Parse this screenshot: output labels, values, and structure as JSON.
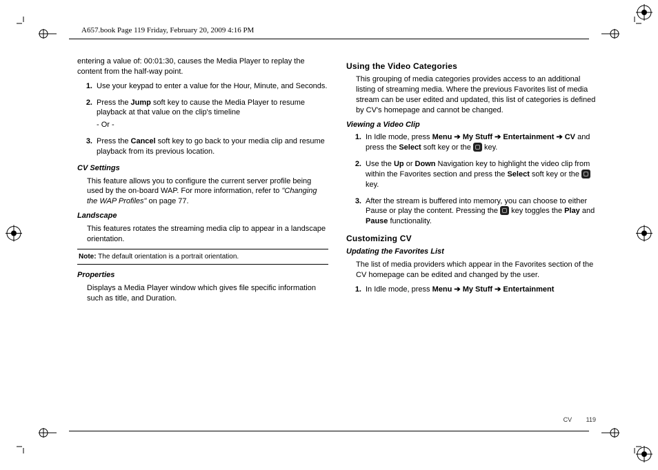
{
  "meta_line": "A657.book  Page 119  Friday, February 20, 2009  4:16 PM",
  "left": {
    "intro": "entering a value of: 00:01:30, causes the Media Player to replay the content from the half-way point.",
    "steps": [
      {
        "n": "1.",
        "t1": "Use your keypad to enter a value for the Hour, Minute, and Seconds."
      },
      {
        "n": "2.",
        "t1": "Press the ",
        "b1": "Jump",
        "t2": " soft key to cause the Media Player to resume playback at that value on the clip's timeline",
        "or": "- Or -"
      },
      {
        "n": "3.",
        "t1": "Press the ",
        "b1": "Cancel",
        "t2": " soft key to go back to your media clip and resume playback from its previous location."
      }
    ],
    "cvset_h": "CV Settings",
    "cvset_p1": "This feature allows you to configure the current server profile being used by the on-board WAP. For more information, refer to ",
    "cvset_ref": "\"Changing the WAP Profiles\"",
    "cvset_p2": "  on page 77.",
    "land_h": "Landscape",
    "land_p": "This features rotates the streaming media clip to appear in a landscape orientation.",
    "note_lbl": "Note:",
    "note_txt": " The default orientation is a portrait orientation.",
    "prop_h": "Properties",
    "prop_p": "Displays a Media Player window which gives file specific information such as title, and Duration."
  },
  "right": {
    "uvcat_h": "Using the Video Categories",
    "uvcat_p": "This grouping of media categories provides access to an additional listing of streaming media. Where the previous Favorites list of media stream can be user edited and updated, this list of categories is defined by CV's homepage and cannot be changed.",
    "vac_h": "Viewing a Video Clip",
    "steps": [
      {
        "n": "1.",
        "pre": "In Idle mode, press ",
        "path": [
          "Menu",
          " ➔ ",
          "My Stuff",
          " ➔ ",
          "Entertainment",
          " ➔ ",
          "CV"
        ],
        "mid": " and press the ",
        "b1": "Select",
        "post": " soft key or the ",
        "keytail": " key."
      },
      {
        "n": "2.",
        "pre": "Use the ",
        "b1": "Up",
        "mid1": " or ",
        "b2": "Down",
        "mid2": " Navigation key to highlight the video clip from within the Favorites section and press the ",
        "b3": "Select",
        "post": " soft key or the ",
        "keytail": " key."
      },
      {
        "n": "3.",
        "pre": "After the stream is buffered into memory, you can choose to either Pause or play the content. Pressing the ",
        "keytail": " key toggles the ",
        "b1": "Play",
        "mid1": " and ",
        "b2": "Pause",
        "post": " functionality."
      }
    ],
    "cust_h": "Customizing CV",
    "updfav_h": "Updating the Favorites List",
    "updfav_p": "The list of media providers which appear in the Favorites section of the CV homepage can be edited and changed by the user.",
    "csteps": [
      {
        "n": "1.",
        "pre": "In Idle mode, press ",
        "path": [
          "Menu",
          " ➔ ",
          "My Stuff",
          " ➔ ",
          "Entertainment"
        ]
      }
    ]
  },
  "footer": {
    "section": "CV",
    "page": "119"
  }
}
